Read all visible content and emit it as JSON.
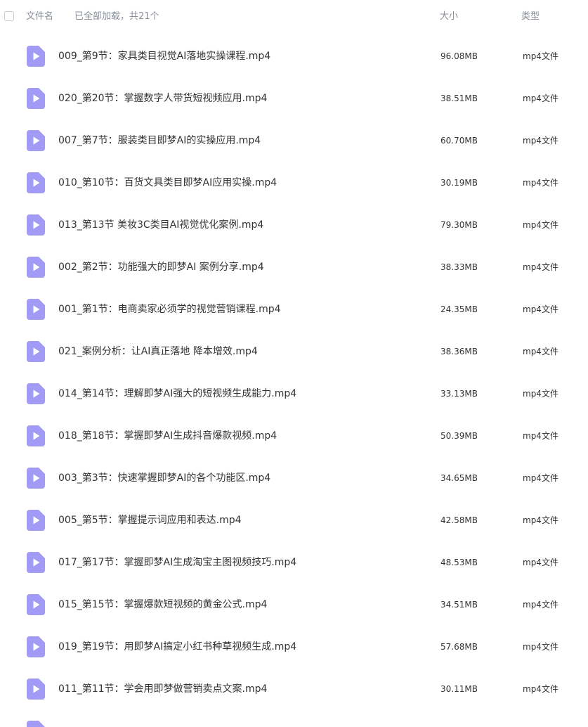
{
  "header": {
    "name_label": "文件名",
    "status": "已全部加载，共21个",
    "size_label": "大小",
    "type_label": "类型"
  },
  "files": [
    {
      "name": "009_第9节：家具类目视觉AI落地实操课程.mp4",
      "size": "96.08MB",
      "type": "mp4文件"
    },
    {
      "name": "020_第20节：掌握数字人带货短视频应用.mp4",
      "size": "38.51MB",
      "type": "mp4文件"
    },
    {
      "name": "007_第7节：服装类目即梦AI的实操应用.mp4",
      "size": "60.70MB",
      "type": "mp4文件"
    },
    {
      "name": "010_第10节：百货文具类目即梦AI应用实操.mp4",
      "size": "30.19MB",
      "type": "mp4文件"
    },
    {
      "name": "013_第13节 美妆3C类目AI视觉优化案例.mp4",
      "size": "79.30MB",
      "type": "mp4文件"
    },
    {
      "name": "002_第2节：功能强大的即梦AI 案例分享.mp4",
      "size": "38.33MB",
      "type": "mp4文件"
    },
    {
      "name": "001_第1节：电商卖家必须学的视觉营销课程.mp4",
      "size": "24.35MB",
      "type": "mp4文件"
    },
    {
      "name": "021_案例分析：让AI真正落地 降本增效.mp4",
      "size": "38.36MB",
      "type": "mp4文件"
    },
    {
      "name": "014_第14节：理解即梦AI强大的短视频生成能力.mp4",
      "size": "33.13MB",
      "type": "mp4文件"
    },
    {
      "name": "018_第18节：掌握即梦AI生成抖音爆款视频.mp4",
      "size": "50.39MB",
      "type": "mp4文件"
    },
    {
      "name": "003_第3节：快速掌握即梦AI的各个功能区.mp4",
      "size": "34.65MB",
      "type": "mp4文件"
    },
    {
      "name": "005_第5节：掌握提示词应用和表达.mp4",
      "size": "42.58MB",
      "type": "mp4文件"
    },
    {
      "name": "017_第17节：掌握即梦AI生成淘宝主图视频技巧.mp4",
      "size": "48.53MB",
      "type": "mp4文件"
    },
    {
      "name": "015_第15节：掌握爆款短视频的黄金公式.mp4",
      "size": "34.51MB",
      "type": "mp4文件"
    },
    {
      "name": "019_第19节：用即梦AI搞定小红书种草视频生成.mp4",
      "size": "57.68MB",
      "type": "mp4文件"
    },
    {
      "name": "011_第11节：学会用即梦做营销卖点文案.mp4",
      "size": "30.11MB",
      "type": "mp4文件"
    }
  ],
  "icon": {
    "name": "video-file-icon",
    "color": "#a29bf5"
  }
}
